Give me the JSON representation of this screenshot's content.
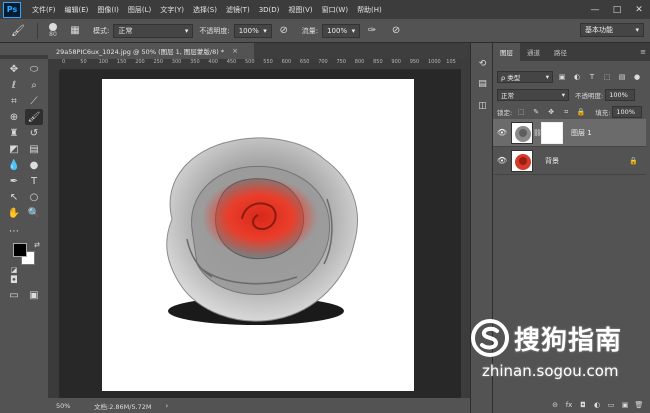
{
  "app": {
    "logo": "Ps"
  },
  "menubar": {
    "items": [
      "文件(F)",
      "编辑(E)",
      "图像(I)",
      "图层(L)",
      "文字(Y)",
      "选择(S)",
      "滤镜(T)",
      "3D(D)",
      "视图(V)",
      "窗口(W)",
      "帮助(H)"
    ],
    "window_controls": [
      "—",
      "□",
      "✕"
    ]
  },
  "options": {
    "brush_size": "80",
    "mode_label": "模式:",
    "mode_value": "正常",
    "opacity_label": "不透明度:",
    "opacity_value": "100%",
    "flow_label": "流量:",
    "flow_value": "100%",
    "workspace": "基本功能"
  },
  "document": {
    "tab_title": "29a58PIC6ux_1024.jpg @ 50% (图层 1, 图层蒙版/8) *",
    "close": "×",
    "ruler_ticks": [
      "0",
      "50",
      "100",
      "150",
      "200",
      "250",
      "300",
      "350",
      "400",
      "450",
      "500",
      "550",
      "600",
      "650",
      "700",
      "750",
      "800",
      "850",
      "900",
      "950",
      "1000",
      "105"
    ]
  },
  "status": {
    "zoom": "50%",
    "doc_size": "文档:2.86M/5.72M",
    "arrow": "›"
  },
  "layers_panel": {
    "tabs": [
      "图层",
      "通道",
      "路径"
    ],
    "filter_label": "ρ 类型",
    "blend_mode": "正常",
    "opacity_label": "不透明度:",
    "opacity_value": "100%",
    "lock_label": "锁定:",
    "fill_label": "填充:",
    "fill_value": "100%",
    "layers": [
      {
        "name": "图层 1",
        "selected": true
      },
      {
        "name": "背景",
        "selected": false
      }
    ],
    "bottom_icons": [
      "⊝",
      "fx",
      "◘",
      "◐",
      "▭",
      "▣",
      "🗑"
    ]
  },
  "watermark": {
    "title": "搜狗指南",
    "url": "zhinan.sogou.com"
  },
  "colors": {
    "app_bg": "#535353",
    "menu_bg": "#3c3c3c",
    "canvas_bg": "#282828",
    "accent": "#31a8ff",
    "rose_highlight": "#e8321e"
  }
}
